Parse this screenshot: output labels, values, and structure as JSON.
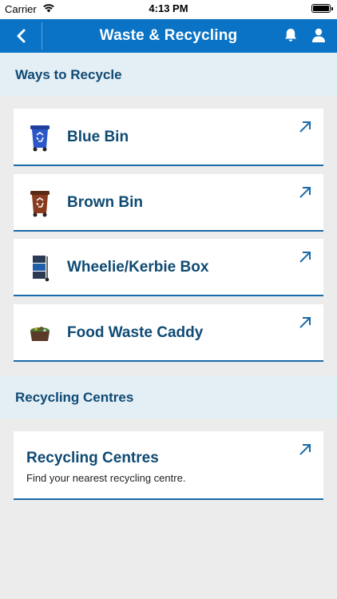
{
  "status_bar": {
    "carrier": "Carrier",
    "time": "4:13 PM"
  },
  "nav": {
    "title": "Waste & Recycling",
    "icons": [
      "back-chevron-icon",
      "bell-icon",
      "user-icon"
    ]
  },
  "ways_section": {
    "header": "Ways to Recycle",
    "items": [
      {
        "label": "Blue Bin",
        "icon": "blue-bin-icon"
      },
      {
        "label": "Brown Bin",
        "icon": "brown-bin-icon"
      },
      {
        "label": "Wheelie/Kerbie Box",
        "icon": "wheelie-kerbie-box-icon"
      },
      {
        "label": "Food Waste Caddy",
        "icon": "food-waste-caddy-icon"
      }
    ]
  },
  "centres_section": {
    "header": "Recycling Centres",
    "card": {
      "title": "Recycling Centres",
      "subtitle": "Find your nearest recycling centre."
    }
  },
  "colors": {
    "nav_bar": "#0a73c5",
    "accent_text": "#0f4a73",
    "section_bg": "#e4eef5",
    "page_bg": "#ececec"
  }
}
